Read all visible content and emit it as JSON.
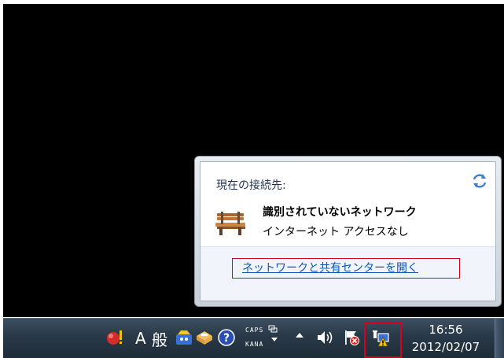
{
  "flyout": {
    "title": "現在の接続先:",
    "network_name": "識別されていないネットワーク",
    "network_status": "インターネット アクセスなし",
    "open_center_link": "ネットワークと共有センターを開く"
  },
  "taskbar": {
    "ime_mode": "A",
    "ime_dictionary": "般",
    "caps_label": "CAPS",
    "kana_label": "KANA",
    "clock_time": "16:56",
    "clock_date": "2012/02/07"
  },
  "icons": {
    "refresh": "refresh-icon",
    "network_bench": "unidentified-network-icon",
    "alert": "alert-icon",
    "ime_toolbar": "ime-toolbar-icon",
    "ime_pad": "ime-pad-icon",
    "help": "help-icon",
    "show_hidden": "show-hidden-icons",
    "volume": "volume-icon",
    "action_center": "action-center-flag-icon",
    "network": "network-no-internet-icon"
  },
  "colors": {
    "desktop": "#000000",
    "link": "#0b56b7",
    "highlight": "#d8001c",
    "taskbar": "#2a3a49"
  }
}
